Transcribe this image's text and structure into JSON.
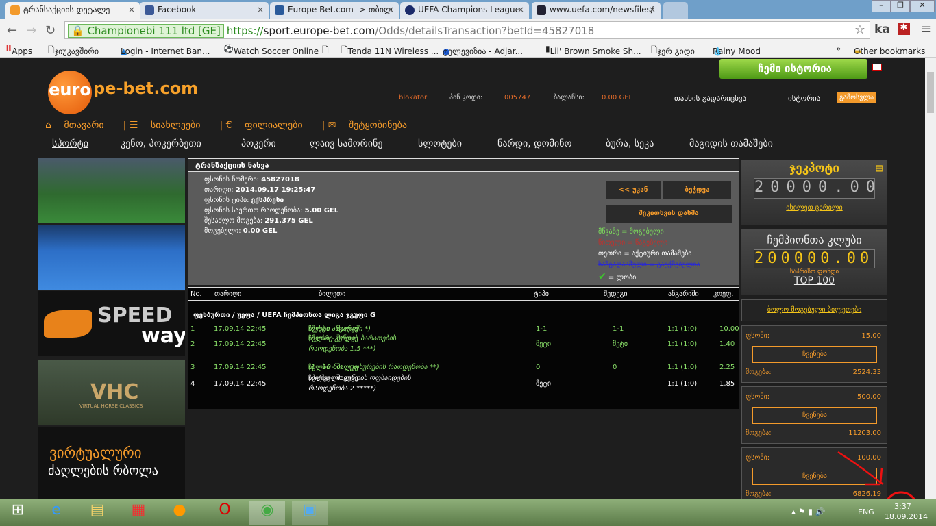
{
  "browser": {
    "tabs": [
      {
        "label": "ტრანსაქციის დეტალე"
      },
      {
        "label": "Facebook"
      },
      {
        "label": "Europe-Bet.com -> თბილ"
      },
      {
        "label": "UEFA Champions League"
      },
      {
        "label": "www.uefa.com/newsfiles/"
      }
    ],
    "ev_cert": "Championebi 111 ltd [GE]",
    "url_scheme": "https://",
    "url_host": "sport.europe-bet.com",
    "url_path": "/Odds/detailsTransaction?betId=45827018",
    "profile": "ka",
    "bookmarks": [
      "Apps",
      "ჯიუკავშირი",
      "Login - Internet Ban...",
      "Watch Soccer Online",
      "",
      "Tenda 11N Wireless ...",
      "ტელევიზია - Adjar...",
      "Lil' Brown Smoke Sh...",
      "ჯერ გიდი",
      "Rainy Mood"
    ],
    "other_bookmarks": "Other bookmarks",
    "more": "»"
  },
  "site": {
    "logo_a": "euro",
    "logo_b": "pe-bet.com",
    "my_history": "ჩემი ისტორია",
    "user": "blokator",
    "pin_label": "პინ კოდი:",
    "pin": "005747",
    "balance_label": "ბალანსი:",
    "balance": "0.00 GEL",
    "transfer": "თანხის გადარიცხვა",
    "history": "ისტორია",
    "logout": "გამოსვლა",
    "nav1": [
      "მთავარი",
      "სიახლეები",
      "ფილიალები",
      "შეტყობინება"
    ],
    "nav2": [
      "სპორტი",
      "კენო, პოკერბეთი",
      "პოკერი",
      "ლაივ სამორინე",
      "სლოტები",
      "ნარდი, დომინო",
      "ბურა, სეკა",
      "მაგიდის თამაშები"
    ],
    "banners": {
      "speedway_a": "SPEED",
      "speedway_b": "way",
      "vhc": "VHC",
      "vhc_sub": "VIRTUAL HORSE CLASSICS",
      "dogs_a": "ვირტუალური",
      "dogs_b": "ძაღლების რბოლა"
    }
  },
  "transaction": {
    "title": "ტრანზაქციის ნახვა",
    "details": [
      {
        "label": "ფსონის ნომერი:",
        "value": "45827018"
      },
      {
        "label": "თარიღი:",
        "value": "2014.09.17 19:25:47"
      },
      {
        "label": "ფსონის ტიპი:",
        "value": "ექსპრესი"
      },
      {
        "label": "ფსონის საერთო რაოდენობა:",
        "value": "5.00 GEL"
      },
      {
        "label": "შესაძლო მოგება:",
        "value": "291.375 GEL"
      },
      {
        "label": "მოგებული:",
        "value": "0.00 GEL"
      }
    ],
    "back": "<< უკან",
    "print": "ბეჭდვა",
    "ask": "შეკითხვის დასმა",
    "legend": {
      "green": "მწვანე = მოგებული",
      "red": "წითელი = წაგებული",
      "white": "თეთრი = აქტიური თამაშები",
      "blue": "ხაზგადასმული = გაუქმებულია",
      "check": "= ლობი"
    }
  },
  "table": {
    "headers": [
      "No.",
      "თარიღი",
      "ბილეთი",
      "ტიპი",
      "შედეგი",
      "ანგარიში",
      "კოეფ."
    ],
    "group": "ფეხბურთი / უეფა / UEFA ჩემპიონთა ლიგა ჯგუფი G",
    "rows": [
      {
        "no": "1",
        "date": "17.09.14 22:45",
        "match": "ჩელსი - შალკე",
        "market": "(ზუსტი ანგარიში *)",
        "market2": "",
        "type": "1-1",
        "result": "1-1",
        "score": "1:1 (1:0)",
        "odds": "10.00"
      },
      {
        "no": "2",
        "date": "17.09.14 22:45",
        "match": "ჩელსი - შალკე",
        "market": "(მეორე გუნდის ბარათების",
        "market2": "რაოდენობა 1.5 ***)",
        "type": "მეტი",
        "result": "მეტი",
        "score": "1:1 (1:0)",
        "odds": "1.40"
      },
      {
        "no": "3",
        "date": "17.09.14 22:45",
        "match": "ჩელსი - შალკე",
        "market": "(1 - 10 წთ. კუთხურების რაოდენობა **)",
        "market2": "",
        "type": "0",
        "result": "0",
        "score": "1:1 (1:0)",
        "odds": "2.25"
      },
      {
        "no": "4",
        "date": "17.09.14 22:45",
        "match": "ჩელსი - შალკე",
        "market": "(პირველი გუნდის ოფსაიდების",
        "market2": "რაოდენობა 2 *****)",
        "type": "მეტი",
        "result": "",
        "score": "1:1 (1:0)",
        "odds": "1.85"
      }
    ]
  },
  "sidebar": {
    "jackpot_title": "ჯეკპოტი",
    "jackpot": "20000.00",
    "jackpot_link": "იხილეთ ცხრილი",
    "club_title": "ჩემპიონთა კლუბი",
    "club": "200000.00",
    "club_sub": "საპრიზო ფონდი",
    "top": "TOP 100",
    "last_won": "ბოლო მოგებული ბილეთები",
    "bet_label": "ფსონი:",
    "show": "ჩვენება",
    "win_label": "მოგება:",
    "cards": [
      {
        "bet": "15.00",
        "win": "2524.33"
      },
      {
        "bet": "500.00",
        "win": "11203.00"
      },
      {
        "bet": "100.00",
        "win": "6826.19"
      }
    ]
  },
  "taskbar": {
    "lang": "ENG",
    "time": "3:37",
    "date": "18.09.2014"
  },
  "colors": {
    "orange": "#f39a2b",
    "green": "#8be36a"
  }
}
